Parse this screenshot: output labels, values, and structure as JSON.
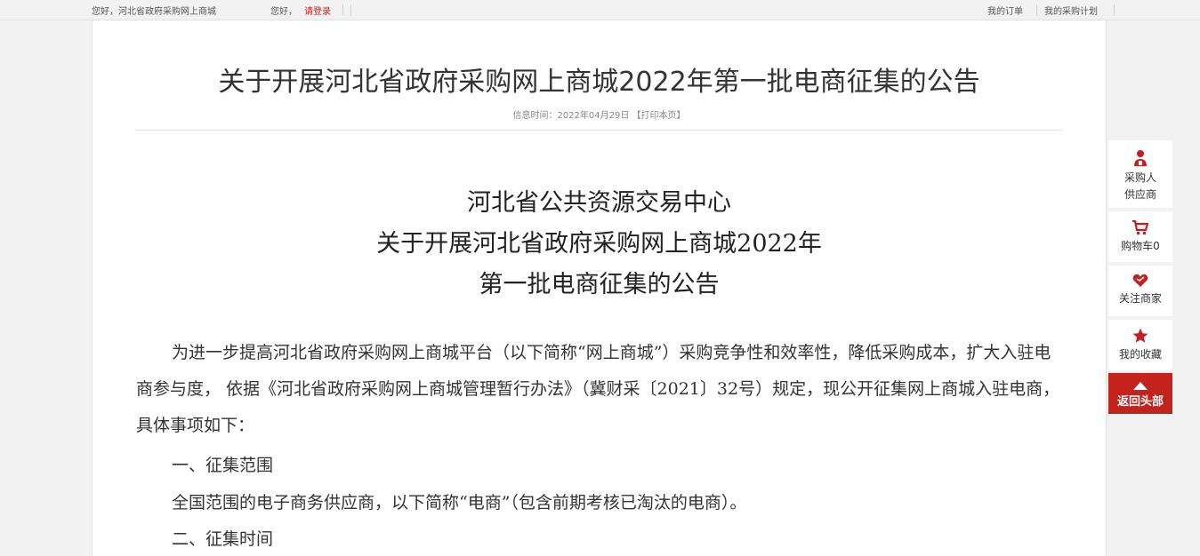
{
  "topbar": {
    "greeting": "您好，河北省政府采购网上商城",
    "hello": "您好，",
    "login_link": "请登录",
    "my_orders": "我的订单",
    "my_purchase_plan": "我的采购计划"
  },
  "article": {
    "title": "关于开展河北省政府采购网上商城2022年第一批电商征集的公告",
    "meta_label": "信息时间：",
    "date": "2022年04月29日",
    "print_link": "【打印本页】",
    "subheading_1": "河北省公共资源交易中心",
    "subheading_2": "关于开展河北省政府采购网上商城2022年",
    "subheading_3": "第一批电商征集的公告",
    "paragraph_1": "为进一步提高河北省政府采购网上商城平台（以下简称“网上商城”）采购竞争性和效率性，降低采购成本，扩大入驻电商参与度， 依据《河北省政府采购网上商城管理暂行办法》（冀财采〔2021〕32号）规定，现公开征集网上商城入驻电商，具体事项如下：",
    "section_1_heading": "一、征集范围",
    "section_1_text": "全国范围的电子商务供应商，以下简称“电商”（包含前期考核已淘汰的电商）。",
    "section_2_heading": "二、征集时间"
  },
  "sidebar": {
    "buyer_label_1": "采购人",
    "buyer_label_2": "供应商",
    "cart_label": "购物车0",
    "follow_label": "关注商家",
    "favorites_label": "我的收藏",
    "back_top_label": "返回头部"
  },
  "icons": {
    "buyer": "user-icon",
    "cart": "cart-icon",
    "follow": "heart-icon",
    "favorites": "star-icon",
    "back_top": "arrow-up-icon"
  },
  "colors": {
    "accent": "#c4231d"
  }
}
